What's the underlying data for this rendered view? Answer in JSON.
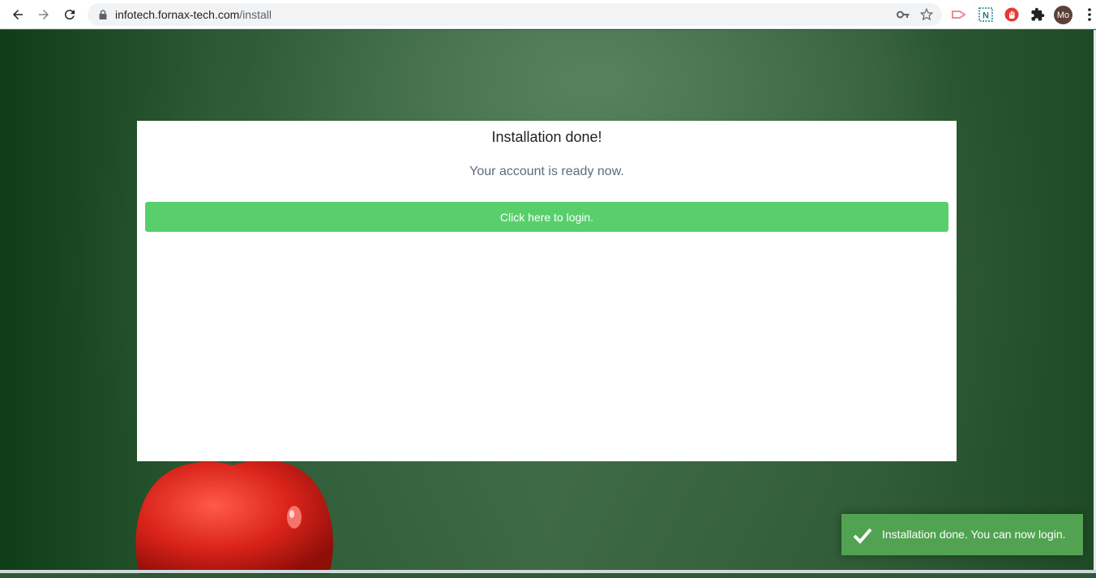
{
  "browser": {
    "url_host": "infotech.fornax-tech.com",
    "url_path": "/install",
    "avatar_initials": "Mo",
    "icons": {
      "back": "arrow-left-icon",
      "forward": "arrow-right-icon",
      "reload": "reload-icon",
      "lock": "lock-icon",
      "key": "key-icon",
      "bookmark": "star-icon",
      "extensions": "puzzle-icon",
      "menu": "vertical-dots-icon"
    }
  },
  "card": {
    "title": "Installation done!",
    "subtitle": "Your account is ready now.",
    "login_button": "Click here to login."
  },
  "toast": {
    "message": "Installation done. You can now login.",
    "icon": "checkmark-icon",
    "color": "#51a351"
  },
  "colors": {
    "button": "#58cf6a",
    "background": "#2f5a35"
  }
}
